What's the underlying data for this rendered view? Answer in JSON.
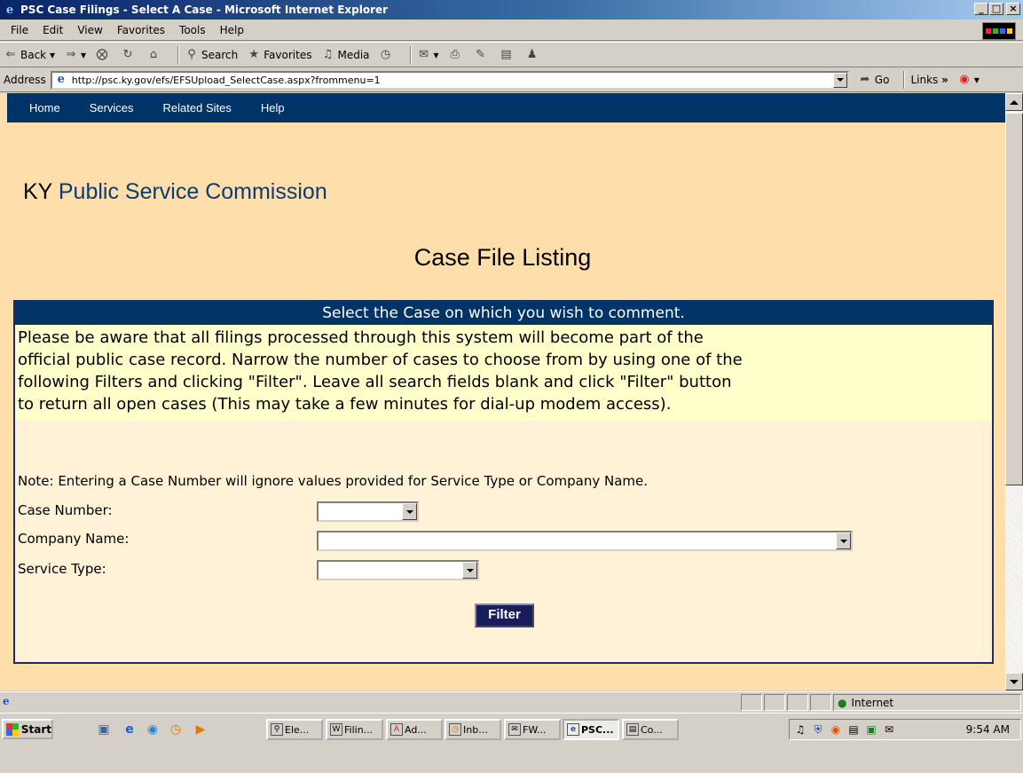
{
  "window": {
    "title": "PSC Case Filings - Select A Case - Microsoft Internet Explorer",
    "min_label": "_",
    "max_label": "□",
    "close_label": "×"
  },
  "menu": [
    "File",
    "Edit",
    "View",
    "Favorites",
    "Tools",
    "Help"
  ],
  "toolbar": {
    "back": "Back",
    "search": "Search",
    "favorites": "Favorites",
    "media": "Media"
  },
  "address": {
    "label": "Address",
    "url": "http://psc.ky.gov/efs/EFSUpload_SelectCase.aspx?frommenu=1",
    "go": "Go",
    "links": "Links"
  },
  "nav": [
    "Home",
    "Services",
    "Related Sites",
    "Help"
  ],
  "brand": {
    "prefix": "KY",
    "name": "Public Service Commission"
  },
  "page_title": "Case File Listing",
  "panel": {
    "header": "Select the Case on which you wish to comment.",
    "intro_lines": [
      "Please be aware that all filings processed through this system will become part of the",
      "official public case record.  Narrow the number of cases to choose from by using one of the",
      "following Filters and clicking \"Filter\". Leave all search fields blank and click \"Filter\" button",
      "to return all open cases (This may take a few minutes for dial-up modem access)."
    ],
    "note": "Note: Entering a Case Number will ignore values provided for Service Type or Company Name.",
    "case_number_label": "Case Number:",
    "company_name_label": "Company Name:",
    "service_type_label": "Service Type:",
    "case_number_value": "",
    "company_name_value": "",
    "service_type_value": "",
    "filter_button": "Filter"
  },
  "status": {
    "zone": "Internet"
  },
  "taskbar": {
    "start": "Start",
    "tasks": [
      "Ele...",
      "Filin...",
      "Ad...",
      "Inb...",
      "FW...",
      "PSC...",
      "Co..."
    ],
    "clock": "9:54 AM"
  },
  "icons": [
    "ie-logo-icon",
    "back-icon",
    "forward-icon",
    "stop-icon",
    "refresh-icon",
    "home-icon",
    "search-icon",
    "favorites-icon",
    "media-icon",
    "history-icon",
    "mail-icon",
    "print-icon",
    "edit-icon",
    "discuss-icon",
    "messenger-icon",
    "go-icon",
    "page-icon",
    "globe-icon",
    "windows-flag-icon"
  ]
}
